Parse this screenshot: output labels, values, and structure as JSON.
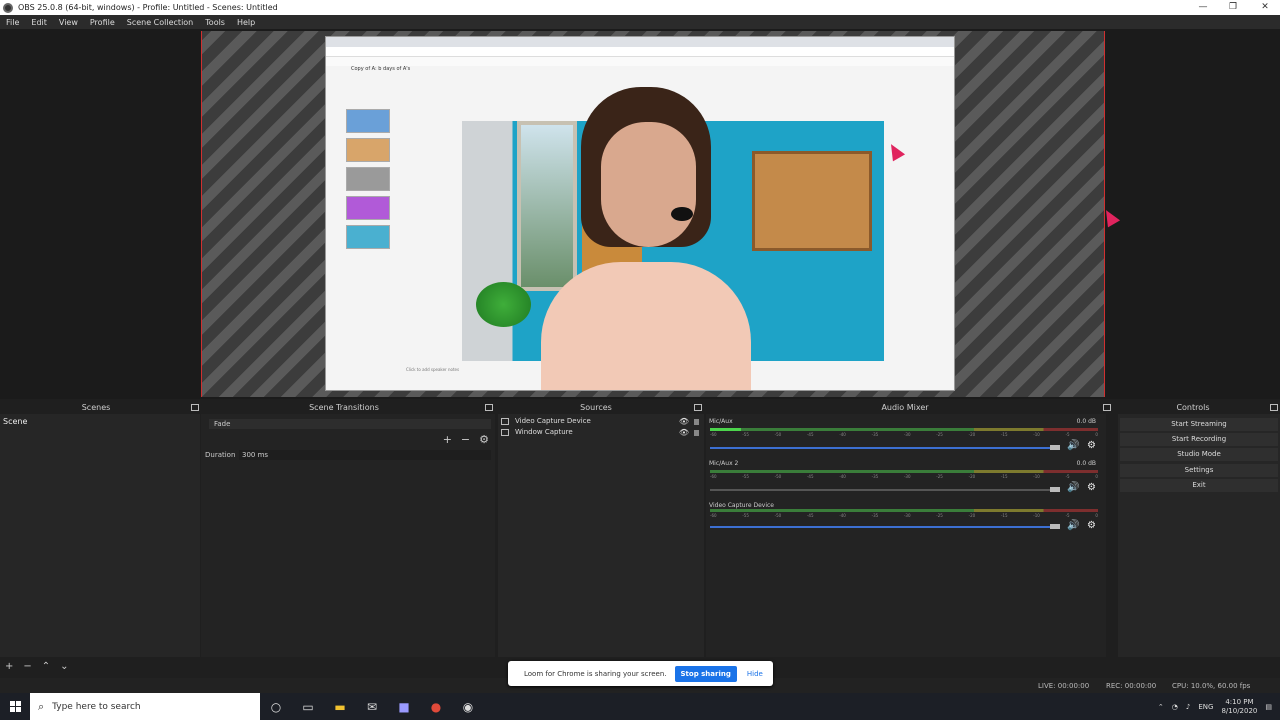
{
  "window": {
    "title": "OBS 25.0.8 (64-bit, windows) - Profile: Untitled - Scenes: Untitled",
    "min": "—",
    "max": "❐",
    "close": "✕"
  },
  "menu": [
    "File",
    "Edit",
    "View",
    "Profile",
    "Scene Collection",
    "Tools",
    "Help"
  ],
  "captured_slide": {
    "title": "Copy of A: b days of A's",
    "footer": "Click to add speaker notes"
  },
  "docks": {
    "scenes": "Scenes",
    "transitions": "Scene Transitions",
    "sources": "Sources",
    "mixer": "Audio Mixer",
    "controls": "Controls"
  },
  "scenes": [
    "Scene"
  ],
  "transitions": {
    "selected": "Fade",
    "duration_label": "Duration",
    "duration_value": "300 ms"
  },
  "sources": [
    "Video Capture Device",
    "Window Capture"
  ],
  "mixer": {
    "tick_labels": [
      "-60",
      "-55",
      "-50",
      "-45",
      "-40",
      "-35",
      "-30",
      "-25",
      "-20",
      "-15",
      "-10",
      "-5",
      "0"
    ],
    "channels": [
      {
        "name": "Mic/Aux",
        "db": "0.0 dB"
      },
      {
        "name": "Mic/Aux 2",
        "db": "0.0 dB"
      },
      {
        "name": "Video Capture Device",
        "db": ""
      }
    ]
  },
  "controls": [
    "Start Streaming",
    "Start Recording",
    "Studio Mode",
    "Settings",
    "Exit"
  ],
  "status": {
    "live": "LIVE: 00:00:00",
    "rec": "REC: 00:00:00",
    "cpu": "CPU: 10.0%, 60.00 fps"
  },
  "toast": {
    "message": "Loom for Chrome is sharing your screen.",
    "stop": "Stop sharing",
    "hide": "Hide"
  },
  "taskbar": {
    "search_placeholder": "Type here to search",
    "lang": "ENG",
    "time": "4:10 PM",
    "date": "8/10/2020"
  }
}
